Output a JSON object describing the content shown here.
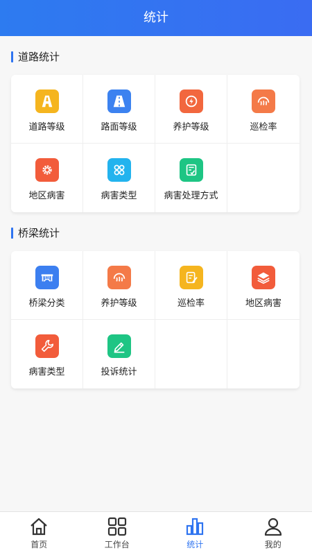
{
  "header": {
    "title": "统计"
  },
  "road_section": {
    "title": "道路统计",
    "items": [
      {
        "label": "道路等级",
        "icon": "road-icon",
        "color": "#f5b51f"
      },
      {
        "label": "路面等级",
        "icon": "road-surface-icon",
        "color": "#3c82f0"
      },
      {
        "label": "养护等级",
        "icon": "maintenance-icon",
        "color": "#f2673e"
      },
      {
        "label": "巡检率",
        "icon": "inspection-icon",
        "color": "#f47a48"
      },
      {
        "label": "地区病害",
        "icon": "gear-icon",
        "color": "#f25c3b"
      },
      {
        "label": "病害类型",
        "icon": "grid-icon",
        "color": "#23b3ee"
      },
      {
        "label": "病害处理方式",
        "icon": "checklist-icon",
        "color": "#1ec584"
      }
    ]
  },
  "bridge_section": {
    "title": "桥梁统计",
    "items": [
      {
        "label": "桥梁分类",
        "icon": "bridge-icon",
        "color": "#3c7ff0"
      },
      {
        "label": "养护等级",
        "icon": "maintenance-wave-icon",
        "color": "#f47a48"
      },
      {
        "label": "巡检率",
        "icon": "edit-doc-icon",
        "color": "#f5b51f"
      },
      {
        "label": "地区病害",
        "icon": "layers-icon",
        "color": "#f25c3b"
      },
      {
        "label": "病害类型",
        "icon": "wrench-icon",
        "color": "#f25c3b"
      },
      {
        "label": "投诉统计",
        "icon": "pen-icon",
        "color": "#1ec584"
      }
    ]
  },
  "tabbar": {
    "tabs": [
      {
        "label": "首页",
        "icon": "home-icon"
      },
      {
        "label": "工作台",
        "icon": "workbench-icon"
      },
      {
        "label": "统计",
        "icon": "stats-icon",
        "active": true
      },
      {
        "label": "我的",
        "icon": "user-icon"
      }
    ],
    "active_color": "#2f74f0"
  }
}
